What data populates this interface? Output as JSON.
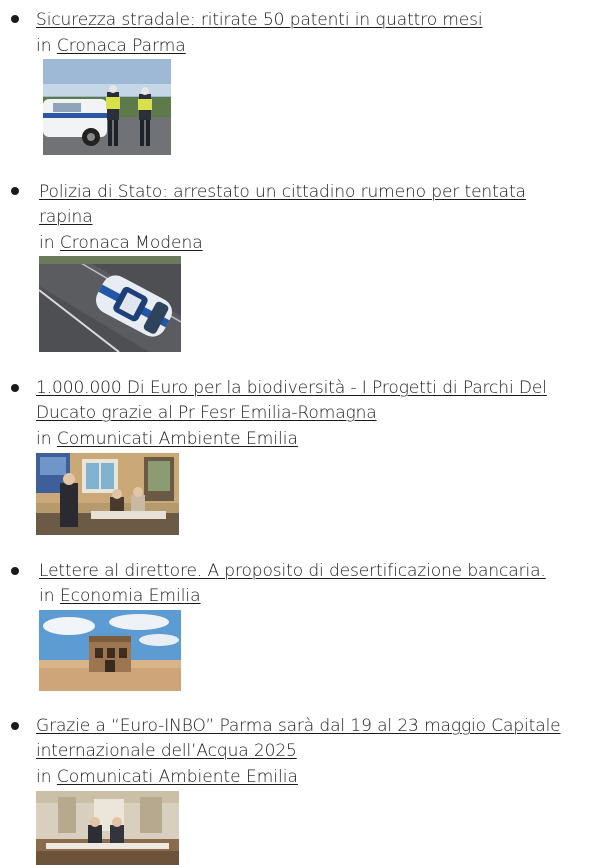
{
  "items": [
    {
      "title": "Sicurezza stradale: ritirate 50 patenti in quattro mesi",
      "prefix": "in",
      "category": "Cronaca Parma",
      "image": "police-car-road-checkpoint-photo"
    },
    {
      "title": "Polizia di Stato: arrestato un cittadino rumeno per tentata rapina",
      "prefix": "in",
      "category": "Cronaca Modena",
      "image": "police-car-aerial-photo"
    },
    {
      "title": "1.000.000 Di Euro per la biodiversità - I Progetti di Parchi Del Ducato grazie al Pr Fesr Emilia-Romagna",
      "prefix": "in",
      "category": "Comunicati Ambiente Emilia",
      "image": "press-conference-photo"
    },
    {
      "title": "Lettere al direttore. A proposito di desertificazione bancaria.",
      "prefix": "in",
      "category": "Economia Emilia",
      "image": "abandoned-building-desert-photo"
    },
    {
      "title": "Grazie a “Euro-INBO” Parma sarà dal 19 al 23 maggio Capitale internazionale dell’Acqua 2025",
      "prefix": "in",
      "category": "Comunicati Ambiente Emilia",
      "image": "meeting-room-photo"
    }
  ]
}
